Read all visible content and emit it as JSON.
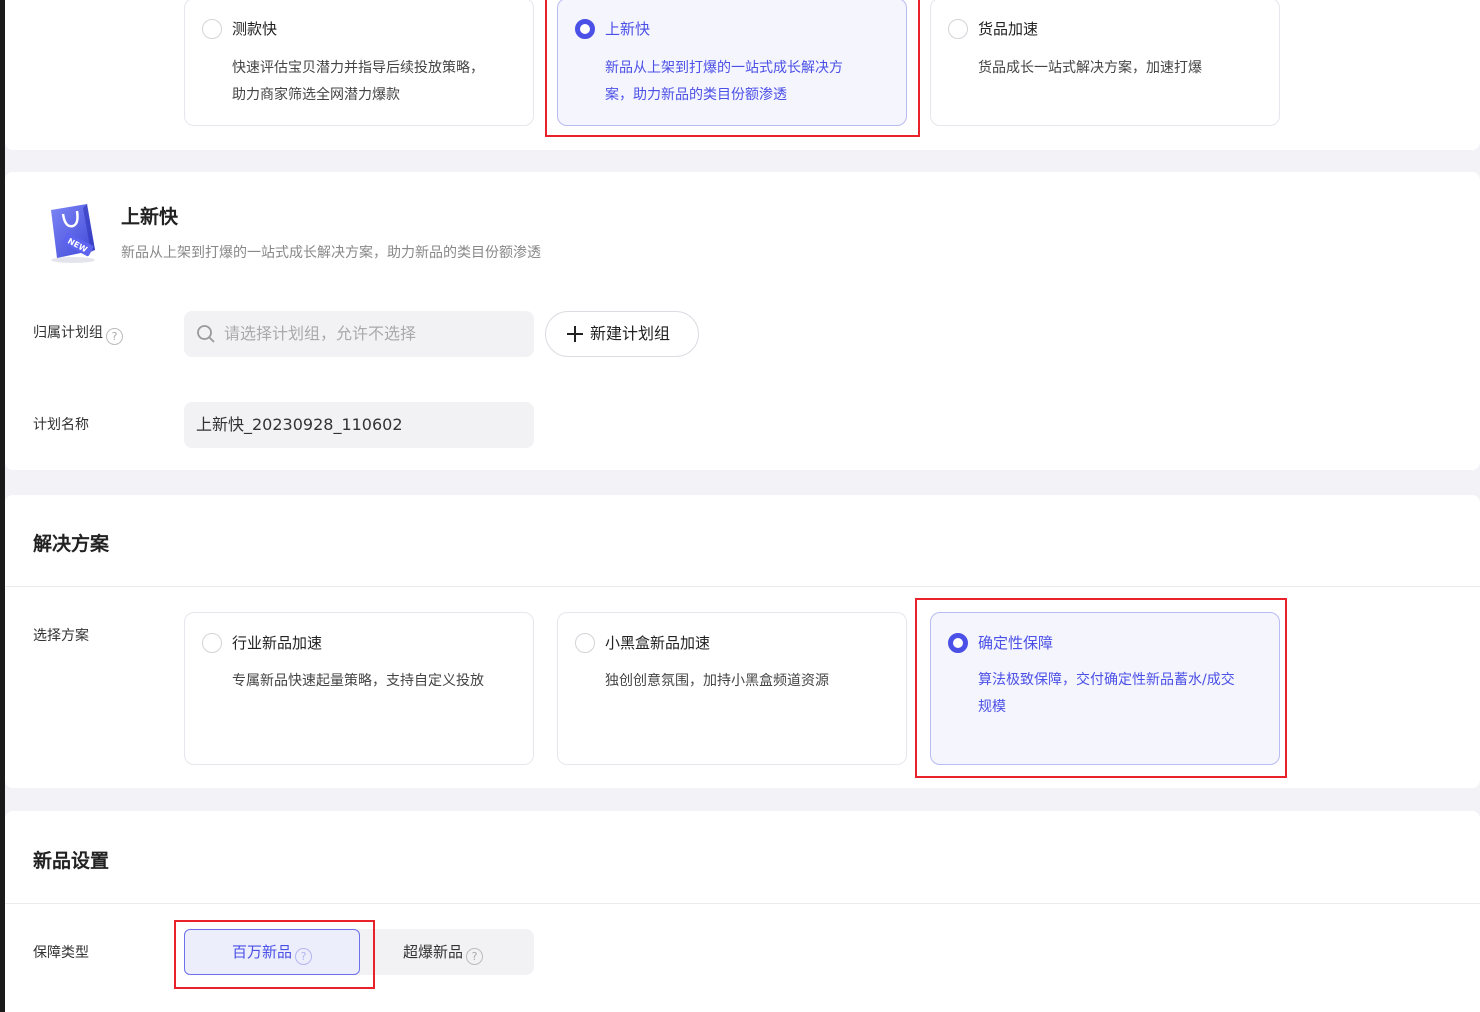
{
  "top_options": [
    {
      "title": "测款快",
      "desc": [
        "快速评估宝贝潜力并指导后续投放策略，",
        "助力商家筛选全网潜力爆款"
      ],
      "selected": false
    },
    {
      "title": "上新快",
      "desc": [
        "新品从上架到打爆的一站式成长解决方",
        "案，助力新品的类目份额渗透"
      ],
      "selected": true
    },
    {
      "title": "货品加速",
      "desc": [
        "货品成长一站式解决方案，加速打爆"
      ],
      "selected": false
    }
  ],
  "product": {
    "title": "上新快",
    "desc": "新品从上架到打爆的一站式成长解决方案，助力新品的类目份额渗透",
    "icon": "new-bag-icon",
    "icon_badge": "NEW"
  },
  "plan_group": {
    "label": "归属计划组",
    "help": "?",
    "placeholder": "请选择计划组，允许不选择",
    "new_button": "新建计划组"
  },
  "plan_name": {
    "label": "计划名称",
    "value": "上新快_20230928_110602"
  },
  "solution": {
    "section_title": "解决方案",
    "label": "选择方案",
    "options": [
      {
        "title": "行业新品加速",
        "desc": [
          "专属新品快速起量策略，支持自定义投放"
        ],
        "selected": false
      },
      {
        "title": "小黑盒新品加速",
        "desc": [
          "独创创意氛围，加持小黑盒频道资源"
        ],
        "selected": false
      },
      {
        "title": "确定性保障",
        "desc": [
          "算法极致保障，交付确定性新品蓄水/成交",
          "规模"
        ],
        "selected": true
      }
    ]
  },
  "new_item": {
    "section_title": "新品设置",
    "guarantee_label": "保障类型",
    "options": [
      {
        "label": "百万新品",
        "help": "?",
        "active": true
      },
      {
        "label": "超爆新品",
        "help": "?",
        "active": false
      }
    ]
  },
  "colors": {
    "accent": "#4b50e6",
    "highlight_border": "#e8212a",
    "selected_bg": "#f5f5fd"
  }
}
